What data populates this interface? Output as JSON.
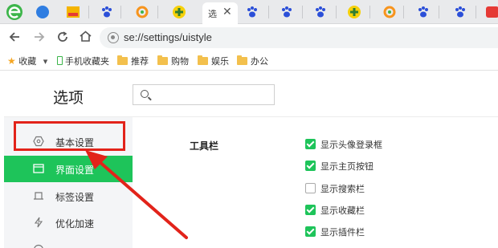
{
  "browser": {
    "active_tab_title": "选",
    "active_tab_close": "✕",
    "address": "se://settings/uistyle"
  },
  "bookmarks": {
    "favorites_label": "收藏",
    "favorites_arrow": "▾",
    "items": [
      "手机收藏夹",
      "推荐",
      "购物",
      "娱乐",
      "办公"
    ]
  },
  "settings": {
    "title": "选项",
    "search_placeholder": "",
    "sidebar": [
      {
        "label": "基本设置",
        "icon": "hexagon-icon",
        "active": false
      },
      {
        "label": "界面设置",
        "icon": "window-icon",
        "active": true
      },
      {
        "label": "标签设置",
        "icon": "tab-icon",
        "active": false
      },
      {
        "label": "优化加速",
        "icon": "lightning-icon",
        "active": false
      }
    ],
    "section_title": "工具栏",
    "options": [
      {
        "label": "显示头像登录框",
        "checked": true
      },
      {
        "label": "显示主页按钮",
        "checked": true
      },
      {
        "label": "显示搜索栏",
        "checked": false
      },
      {
        "label": "显示收藏栏",
        "checked": true
      },
      {
        "label": "显示插件栏",
        "checked": true
      }
    ]
  },
  "colors": {
    "accent_green": "#1ec45a",
    "annotation_red": "#e2231a"
  }
}
